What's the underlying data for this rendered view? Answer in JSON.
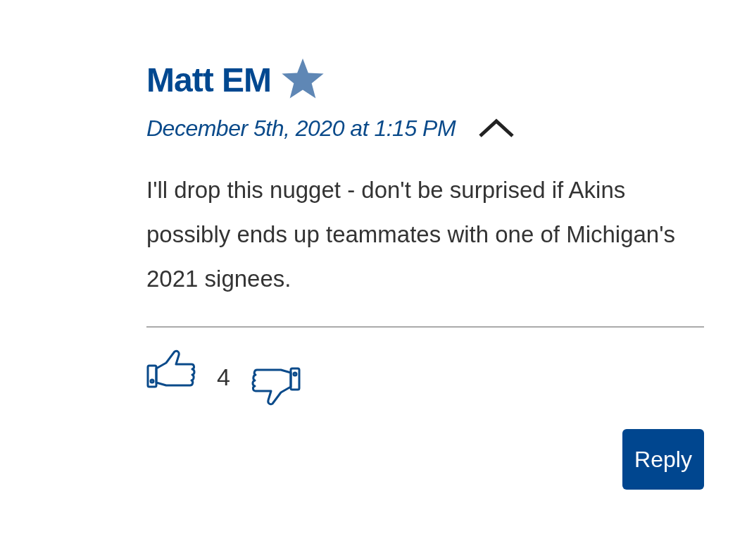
{
  "comment": {
    "author": "Matt EM",
    "timestamp": "December 5th, 2020 at 1:15 PM",
    "body": "I'll drop this nugget - don't be surprised if Akins possibly ends up teammates with one of Michigan's 2021 signees.",
    "vote_count": "4",
    "reply_button": "Reply"
  }
}
